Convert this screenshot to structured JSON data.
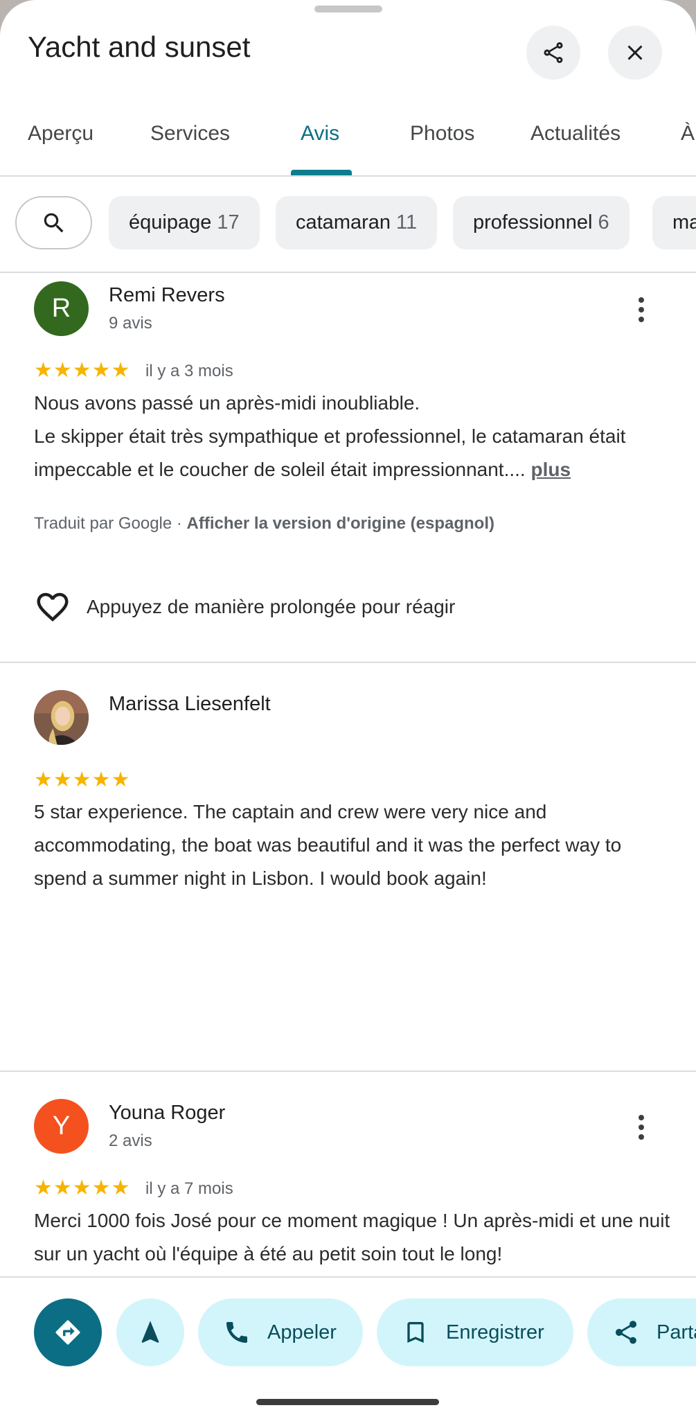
{
  "header": {
    "title": "Yacht and sunset"
  },
  "tabs": [
    {
      "label": "Aperçu"
    },
    {
      "label": "Services"
    },
    {
      "label": "Avis"
    },
    {
      "label": "Photos"
    },
    {
      "label": "Actualités"
    },
    {
      "label": "À"
    }
  ],
  "active_tab": "Avis",
  "filters": [
    {
      "label": "équipage",
      "count": "17"
    },
    {
      "label": "catamaran",
      "count": "11"
    },
    {
      "label": "professionnel",
      "count": "6"
    },
    {
      "label": "ma",
      "count": ""
    }
  ],
  "reviews": [
    {
      "avatar_letter": "R",
      "avatar_color": "#33691e",
      "name": "Remi Revers",
      "meta": "9 avis",
      "stars": "★★★★★",
      "rating": 5,
      "time": "il y a 3 mois",
      "text": "Nous avons passé un après-midi inoubliable.\nLe skipper était très sympathique et professionnel, le catamaran était impeccable et le coucher de soleil était impressionnant.... ",
      "more": "plus",
      "translated_prefix": "Traduit par Google · ",
      "translated_link": "Afficher la version d'origine (espagnol)",
      "react_label": "Appuyez de manière prolongée pour réagir"
    },
    {
      "name": "Marissa Liesenfelt",
      "stars": "★★★★★",
      "rating": 5,
      "text": "5 star experience. The captain and crew were very nice and accommodating, the boat was beautiful and it was the perfect way to spend a summer night in Lisbon. I would book again!"
    },
    {
      "avatar_letter": "Y",
      "avatar_color": "#f4511e",
      "name": "Youna Roger",
      "meta": "2 avis",
      "stars": "★★★★★",
      "rating": 5,
      "time": "il y a 7 mois",
      "text": "Merci 1000 fois José pour ce moment magique ! Un après-midi et une nuit sur un yacht où l'équipe à été au petit soin tout le long!"
    }
  ],
  "actions": {
    "call": "Appeler",
    "save": "Enregistrer",
    "share": "Parta"
  },
  "colors": {
    "accent": "#0b7d8f",
    "pill_bg": "#d2f5fb",
    "star": "#f6b400"
  }
}
